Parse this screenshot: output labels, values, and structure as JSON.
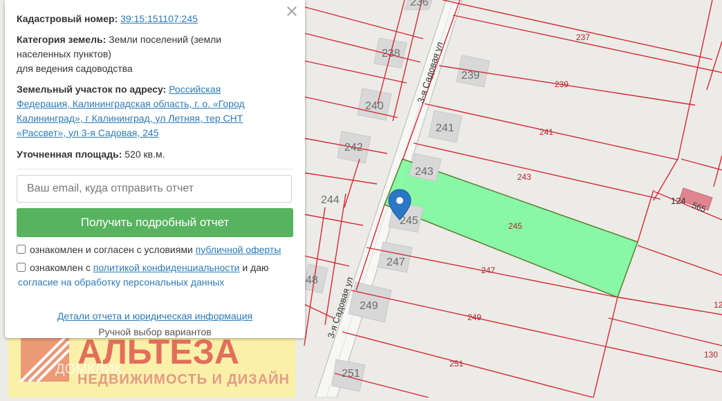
{
  "panel": {
    "close_icon": "close-icon",
    "cadastral_label": "Кадастровый номер:",
    "cadastral_number": "39:15:151107:245",
    "category_label": "Категория земель:",
    "category_value": "Земли поселений (земли",
    "category_value_line2": "населенных пунктов)",
    "usage": "для ведения садоводства",
    "address_label": "Земельный участок по адресу:",
    "address_link_1": "Российская",
    "address_link_2": "Федерация, Калининградская область, г. о. «Город",
    "address_link_3": "Калининград», г Калининград, ул Летняя, тер СНТ",
    "address_link_4": "«Рассвет», ул 3-я Садовая, 245",
    "area_label": "Уточненная площадь:",
    "area_value": "520 кв.м.",
    "email_placeholder": "Ваш email, куда отправить отчет",
    "report_button": "Получить подробный отчет",
    "consent1_text": "ознакомлен и согласен с условиями",
    "consent1_link": "публичной оферты",
    "consent2_text": "ознакомлен с",
    "consent2_link": "политикой конфиденциальности",
    "consent2_tail": "и даю",
    "consent2_link2": "согласие на обработку персональных данных",
    "details_link": "Детали отчета и юридическая информация",
    "manual_select": "Ручной выбор вариантов"
  },
  "map": {
    "highlight_color": "#7dfa9f",
    "boundary_color": "#d42a35",
    "buildings": [
      "236",
      "238",
      "239",
      "240",
      "241",
      "242",
      "243",
      "244",
      "245",
      "247",
      "248",
      "249",
      "251",
      "565"
    ],
    "plots": [
      "237",
      "239",
      "241",
      "243",
      "245",
      "247",
      "249",
      "251",
      "124",
      "130",
      "12",
      "558"
    ],
    "streets": [
      "3-я Садовая ул",
      "3-я Садовая ул"
    ],
    "marker_icon": "map-pin-icon"
  },
  "watermark": {
    "brand": "АЛЬТЕЗА",
    "tagline": "НЕДВИЖИМОСТЬ И ДИЗАЙН",
    "overlay_text": "ДОМКЛИК"
  }
}
